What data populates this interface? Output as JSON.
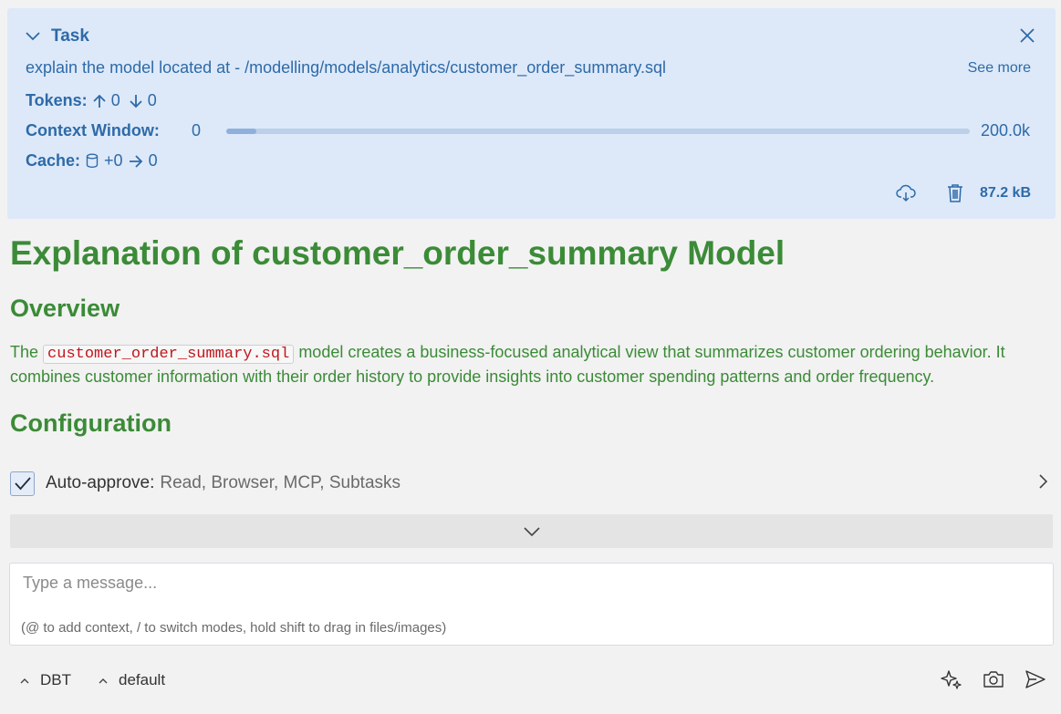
{
  "task": {
    "title": "Task",
    "text": "explain the model located at - /modelling/models/analytics/customer_order_summary.sql",
    "see_more": "See more",
    "tokens_label": "Tokens:",
    "tokens_up": "0",
    "tokens_down": "0",
    "context_label": "Context Window:",
    "context_used": "0",
    "context_max": "200.0k",
    "context_fill_fraction": 0.04,
    "cache_label": "Cache:",
    "cache_add": "+0",
    "cache_value": "0",
    "size": "87.2 kB"
  },
  "content": {
    "heading": "Explanation of customer_order_summary Model",
    "section_overview": "Overview",
    "para_prefix": "The",
    "para_code": "customer_order_summary.sql",
    "para_rest": "model creates a business-focused analytical view that summarizes customer ordering behavior. It combines customer information with their order history to provide insights into customer spending patterns and order frequency.",
    "section_next": "Configuration"
  },
  "auto_approve": {
    "label": "Auto-approve:",
    "values": "Read, Browser, MCP, Subtasks",
    "checked": true
  },
  "input": {
    "placeholder": "Type a message...",
    "hint": "(@ to add context, / to switch modes, hold shift to drag in files/images)"
  },
  "bottom": {
    "mode": "DBT",
    "config": "default"
  },
  "colors": {
    "task_bg": "#dde9f9",
    "task_text": "#2e6aa8",
    "heading_green": "#3b8b37",
    "code_red": "#c0161c"
  }
}
